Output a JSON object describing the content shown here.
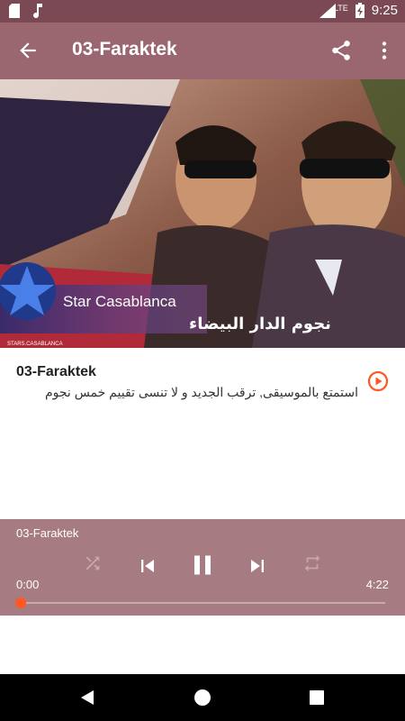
{
  "status": {
    "time": "9:25",
    "network": "LTE"
  },
  "appbar": {
    "title": "03-Faraktek"
  },
  "hero": {
    "brand": "Star Casablanca",
    "subtitle": "نجوم الدار البيضاء",
    "badge": "Star Casablanca",
    "handle": "STARS.CASABLANCA"
  },
  "track": {
    "name": "03-Faraktek",
    "description": "استمتع بالموسيقى, ترقب الجديد و لا تنسى تقييم خمس نجوم"
  },
  "player": {
    "title": "03-Faraktek",
    "current_time": "0:00",
    "duration": "4:22",
    "progress": 0.0
  },
  "colors": {
    "statusbar": "#7a4953",
    "appbar": "#9a6670",
    "player": "#a67b82",
    "accent": "#ff5722"
  }
}
